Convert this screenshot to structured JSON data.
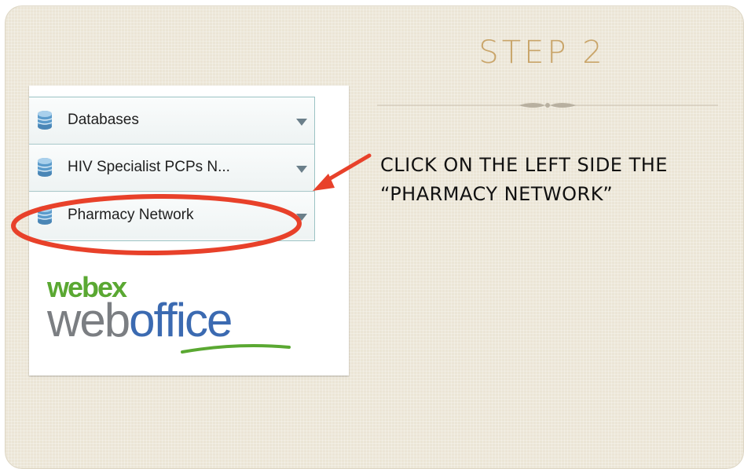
{
  "slide": {
    "title": "STEP 2",
    "instruction": "CLICK ON THE LEFT SIDE THE “PHARMACY NETWORK”"
  },
  "sidebar": {
    "items": [
      {
        "label": "Databases",
        "icon": "database-icon"
      },
      {
        "label": "HIV Specialist PCPs N...",
        "icon": "database-icon"
      },
      {
        "label": "Pharmacy Network",
        "icon": "database-icon"
      }
    ]
  },
  "logo": {
    "brand_top": "webex",
    "brand_main_gray": "web",
    "brand_main_blue": "office"
  },
  "colors": {
    "slide_background": "#ebe5d6",
    "title": "#c9a56a",
    "highlight_ellipse": "#e8412a",
    "arrow": "#e8412a",
    "webex_green": "#5aa832",
    "weboffice_blue": "#3b6ab1"
  }
}
